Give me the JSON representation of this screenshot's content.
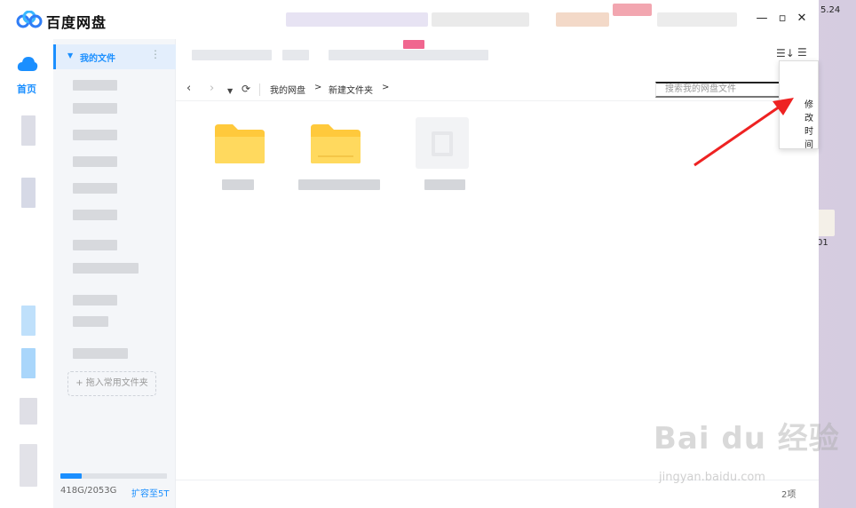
{
  "app": {
    "title": "百度网盘"
  },
  "rail": {
    "home_label": "首页"
  },
  "sidebar": {
    "header_label": "我的文件",
    "add_folder": "+ 拖入常用文件夹",
    "storage_text": "418G/2053G",
    "storage_fraction": 0.2,
    "upgrade_label": "扩容至5T"
  },
  "breadcrumb": {
    "root": "我的网盘",
    "sep1": ">",
    "current": "新建文件夹",
    "sep2": ">"
  },
  "search": {
    "placeholder": "搜索我的网盘文件"
  },
  "dropdown": {
    "visible_item": "修改时间"
  },
  "main": {
    "item_count": "2项"
  },
  "desktop": {
    "time_fragment": "5.24",
    "folder_label_fragment": "01"
  },
  "watermark": {
    "brand": "Bai du 经验",
    "url": "jingyan.baidu.com"
  },
  "colors": {
    "accent": "#1b8fff",
    "folder": "#ffc93c",
    "arrow": "#ee2222"
  }
}
